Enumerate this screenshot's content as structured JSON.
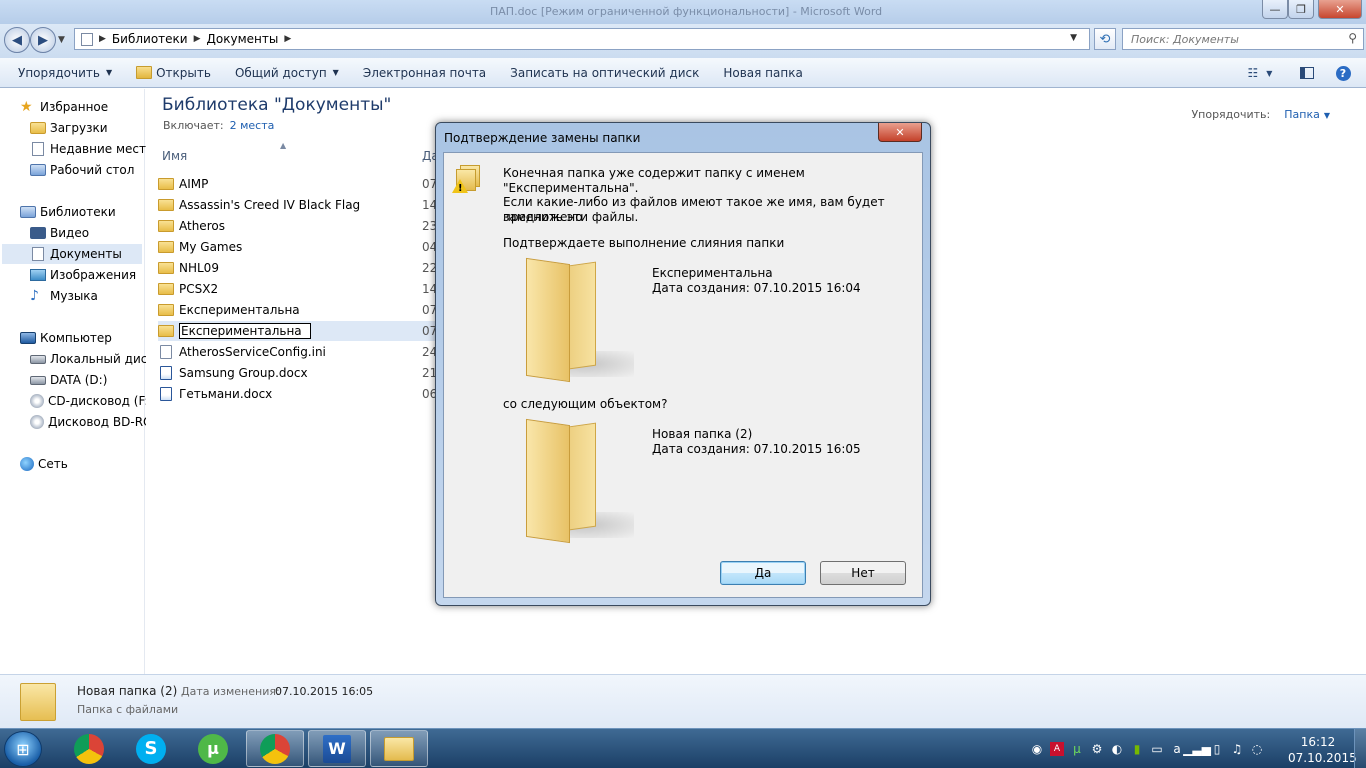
{
  "window": {
    "title": "ПАП.doc [Режим ограниченной функциональности] - Microsoft Word",
    "min": "—",
    "max": "❐",
    "close": "✕"
  },
  "address": {
    "segments": [
      "Библиотеки",
      "Документы"
    ],
    "search_placeholder": "Поиск: Документы"
  },
  "toolbar": {
    "organize": "Упорядочить",
    "open": "Открыть",
    "share": "Общий доступ",
    "email": "Электронная почта",
    "burn": "Записать на оптический диск",
    "new_folder": "Новая папка"
  },
  "nav": {
    "favorites": "Избранное",
    "downloads": "Загрузки",
    "recent": "Недавние места",
    "desktop": "Рабочий стол",
    "libraries": "Библиотеки",
    "video": "Видео",
    "documents": "Документы",
    "images": "Изображения",
    "music": "Музыка",
    "computer": "Компьютер",
    "local_disk": "Локальный диск",
    "data_d": "DATA (D:)",
    "cd_f": "CD-дисковод (F:)",
    "bd": "Дисковод BD-RO",
    "network": "Сеть"
  },
  "main": {
    "title": "Библиотека \"Документы\"",
    "includes_label": "Включает:",
    "includes_link": "2 места",
    "arrange_label": "Упорядочить:",
    "arrange_value": "Папка",
    "col_name": "Имя",
    "col_date": "Да",
    "files": [
      {
        "name": "AIMP",
        "date": "07",
        "type": "folder"
      },
      {
        "name": "Assassin's Creed IV Black Flag",
        "date": "14",
        "type": "folder"
      },
      {
        "name": "Atheros",
        "date": "23",
        "type": "folder"
      },
      {
        "name": "My Games",
        "date": "04",
        "type": "folder"
      },
      {
        "name": "NHL09",
        "date": "22",
        "type": "folder"
      },
      {
        "name": "PCSX2",
        "date": "14",
        "type": "folder"
      },
      {
        "name": "Експериментальна",
        "date": "07",
        "type": "folder"
      },
      {
        "name": "Експериментальна",
        "date": "07",
        "type": "folder-rename"
      },
      {
        "name": "AtherosServiceConfig.ini",
        "date": "24",
        "type": "file"
      },
      {
        "name": "Samsung Group.docx",
        "date": "21",
        "type": "word"
      },
      {
        "name": "Гетьмани.docx",
        "date": "06",
        "type": "word"
      }
    ]
  },
  "details": {
    "name": "Новая папка (2)",
    "modified_label": "Дата изменения:",
    "modified_value": "07.10.2015 16:05",
    "type": "Папка с файлами"
  },
  "dialog": {
    "title": "Подтверждение замены папки",
    "close": "✕",
    "line1": "Конечная папка уже содержит папку с именем \"Експериментальна\".",
    "line2a": "Если какие-либо из файлов имеют такое же имя, вам будет предложено",
    "line2b": "заменить эти файлы.",
    "line3": "Подтверждаете выполнение слияния папки",
    "folder1_name": "Експериментальна",
    "folder1_date": "Дата создания: 07.10.2015 16:04",
    "with_label": "со следующим объектом?",
    "folder2_name": "Новая папка (2)",
    "folder2_date": "Дата создания: 07.10.2015 16:05",
    "yes": "Да",
    "no": "Нет"
  },
  "taskbar": {
    "start": "⊞",
    "time": "16:12",
    "date": "07.10.2015"
  },
  "colors": {
    "accent": "#1f5fb0",
    "selected": "#dde8f6"
  }
}
